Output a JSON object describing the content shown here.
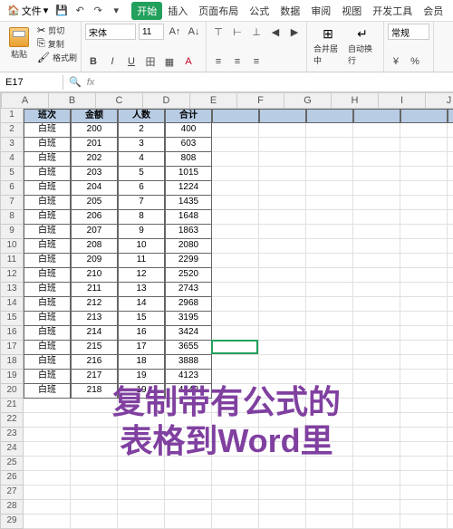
{
  "menu": {
    "file": "文件",
    "items": [
      "开始",
      "插入",
      "页面布局",
      "公式",
      "数据",
      "审阅",
      "视图",
      "开发工具",
      "会员"
    ],
    "activeIndex": 0,
    "home": "🏠",
    "dd": "▾",
    "save": "💾",
    "undo": "↶",
    "redo": "↷"
  },
  "ribbon": {
    "paste": "粘贴",
    "cut": "剪切",
    "copy": "复制",
    "fmt": "格式刷",
    "font": "宋体",
    "size": "11",
    "mergeBtn": "合并居中",
    "wrapBtn": "自动换行",
    "numFmt": "常规",
    "bold": "B",
    "italic": "I",
    "under": "U",
    "sup": "A",
    "sub": "A",
    "fill": "▦",
    "border": "田",
    "aleft": "≡",
    "acenter": "≡",
    "aright": "≡",
    "atop": "⊤",
    "amid": "⊢",
    "abot": "⊥",
    "indL": "◀",
    "indR": "▶",
    "pct": "%",
    "curr": "¥",
    "scissors": "✂",
    "brush": "🖌",
    "merge": "⊞",
    "wrap": "↵"
  },
  "nameBox": "E17",
  "fx": "fx",
  "search": "🔍",
  "cols": [
    "A",
    "B",
    "C",
    "D",
    "E",
    "F",
    "G",
    "H",
    "I",
    "J"
  ],
  "headers": [
    "班次",
    "金额",
    "人数",
    "合计"
  ],
  "rows": [
    [
      "白班",
      "200",
      "2",
      "400"
    ],
    [
      "白班",
      "201",
      "3",
      "603"
    ],
    [
      "白班",
      "202",
      "4",
      "808"
    ],
    [
      "白班",
      "203",
      "5",
      "1015"
    ],
    [
      "白班",
      "204",
      "6",
      "1224"
    ],
    [
      "白班",
      "205",
      "7",
      "1435"
    ],
    [
      "白班",
      "206",
      "8",
      "1648"
    ],
    [
      "白班",
      "207",
      "9",
      "1863"
    ],
    [
      "白班",
      "208",
      "10",
      "2080"
    ],
    [
      "白班",
      "209",
      "11",
      "2299"
    ],
    [
      "白班",
      "210",
      "12",
      "2520"
    ],
    [
      "白班",
      "211",
      "13",
      "2743"
    ],
    [
      "白班",
      "212",
      "14",
      "2968"
    ],
    [
      "白班",
      "213",
      "15",
      "3195"
    ],
    [
      "白班",
      "214",
      "16",
      "3424"
    ],
    [
      "白班",
      "215",
      "17",
      "3655"
    ],
    [
      "白班",
      "216",
      "18",
      "3888"
    ],
    [
      "白班",
      "217",
      "19",
      "4123"
    ],
    [
      "白班",
      "218",
      "19",
      "4142"
    ]
  ],
  "totalRows": 29,
  "activeCol": 4,
  "activeRow": 16,
  "overlay": {
    "line1": "复制带有公式的",
    "line2": "表格到Word里"
  }
}
